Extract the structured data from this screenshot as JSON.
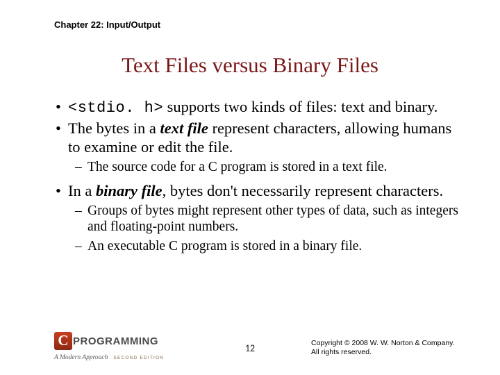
{
  "chapter": "Chapter 22: Input/Output",
  "title": "Text Files versus Binary Files",
  "bullets": {
    "b1a_code": "<stdio. h>",
    "b1a_rest": " supports two kinds of files: text and binary.",
    "b1b_pre": "The bytes in a ",
    "b1b_em": "text file",
    "b1b_post": " represent characters, allowing humans to examine or edit the file.",
    "b2a": "The source code for a C program is stored in a text file.",
    "b1c_pre": "In a ",
    "b1c_em": "binary file",
    "b1c_post": ", bytes don't necessarily represent characters.",
    "b2b": "Groups of bytes might represent other types of data, such as integers and floating-point numbers.",
    "b2c": "An executable C program is stored in a binary file."
  },
  "logo": {
    "c": "C",
    "word": "PROGRAMMING",
    "sub": "A Modern Approach",
    "edition": "SECOND EDITION"
  },
  "pagenum": "12",
  "copyright": {
    "line1": "Copyright © 2008 W. W. Norton & Company.",
    "line2": "All rights reserved."
  }
}
